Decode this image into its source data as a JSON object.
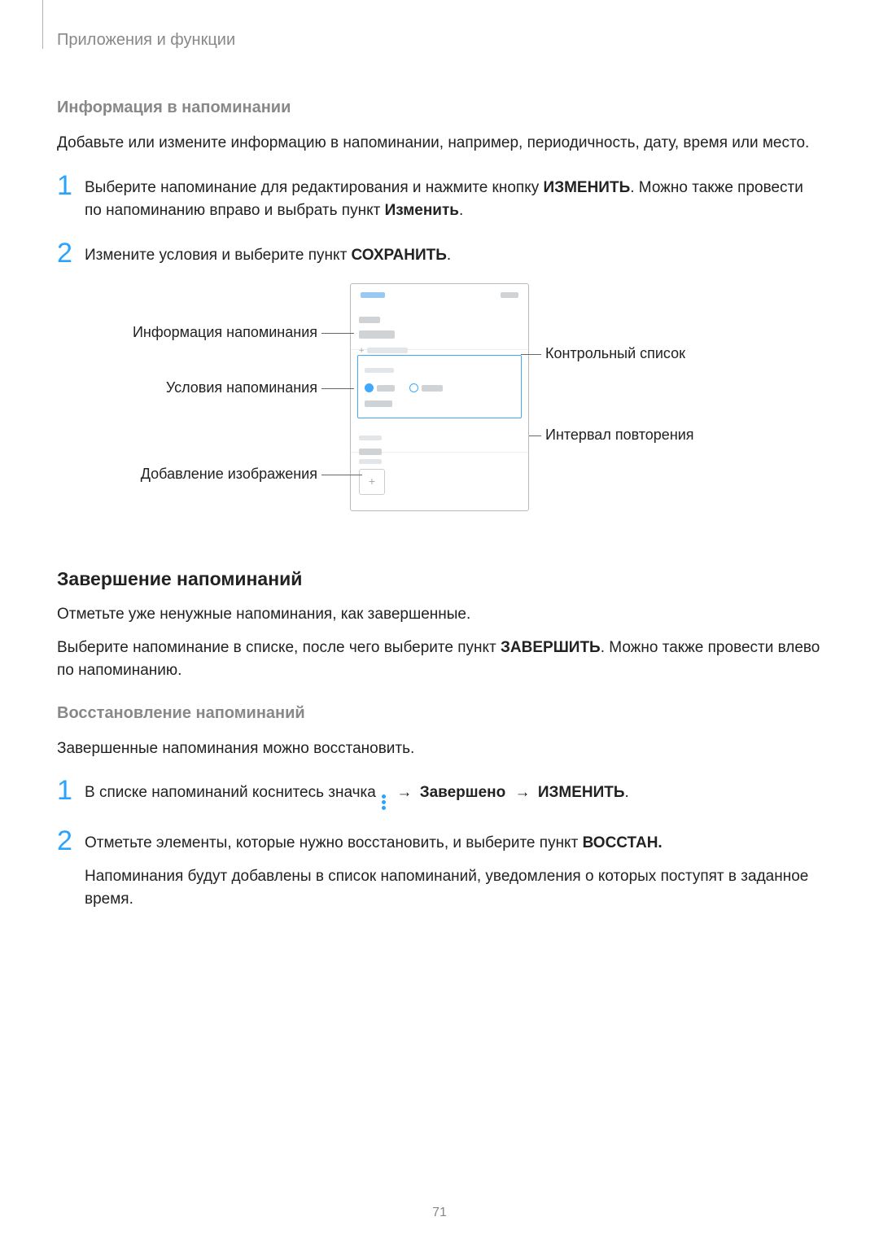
{
  "header": {
    "breadcrumb": "Приложения и функции"
  },
  "sections": {
    "info": {
      "title": "Информация в напоминании",
      "intro": "Добавьте или измените информацию в напоминании, например, периодичность, дату, время или место.",
      "step1_a": "Выберите напоминание для редактирования и нажмите кнопку ",
      "step1_b": "ИЗМЕНИТЬ",
      "step1_c": ". Можно также провести по напоминанию вправо и выбрать пункт ",
      "step1_d": "Изменить",
      "step1_e": ".",
      "step2_a": "Измените условия и выберите пункт ",
      "step2_b": "СОХРАНИТЬ",
      "step2_c": "."
    },
    "callouts": {
      "left1": "Информация напоминания",
      "left2": "Условия напоминания",
      "left3": "Добавление изображения",
      "right1": "Контрольный список",
      "right2": "Интервал повторения"
    },
    "complete": {
      "title": "Завершение напоминаний",
      "p1": "Отметьте уже ненужные напоминания, как завершенные.",
      "p2_a": "Выберите напоминание в списке, после чего выберите пункт ",
      "p2_b": "ЗАВЕРШИТЬ",
      "p2_c": ". Можно также провести влево по напоминанию.",
      "restore_title": "Восстановление напоминаний",
      "restore_p": "Завершенные напоминания можно восстановить.",
      "r1_a": "В списке напоминаний коснитесь значка ",
      "r1_b": "Завершено",
      "r1_c": "ИЗМЕНИТЬ",
      "r1_d": ".",
      "r2_a": "Отметьте элементы, которые нужно восстановить, и выберите пункт ",
      "r2_b": "ВОССТАН.",
      "r2_p": "Напоминания будут добавлены в список напоминаний, уведомления о которых поступят в заданное время."
    }
  },
  "nums": {
    "one": "1",
    "two": "2"
  },
  "arrow": "→",
  "page_number": "71"
}
